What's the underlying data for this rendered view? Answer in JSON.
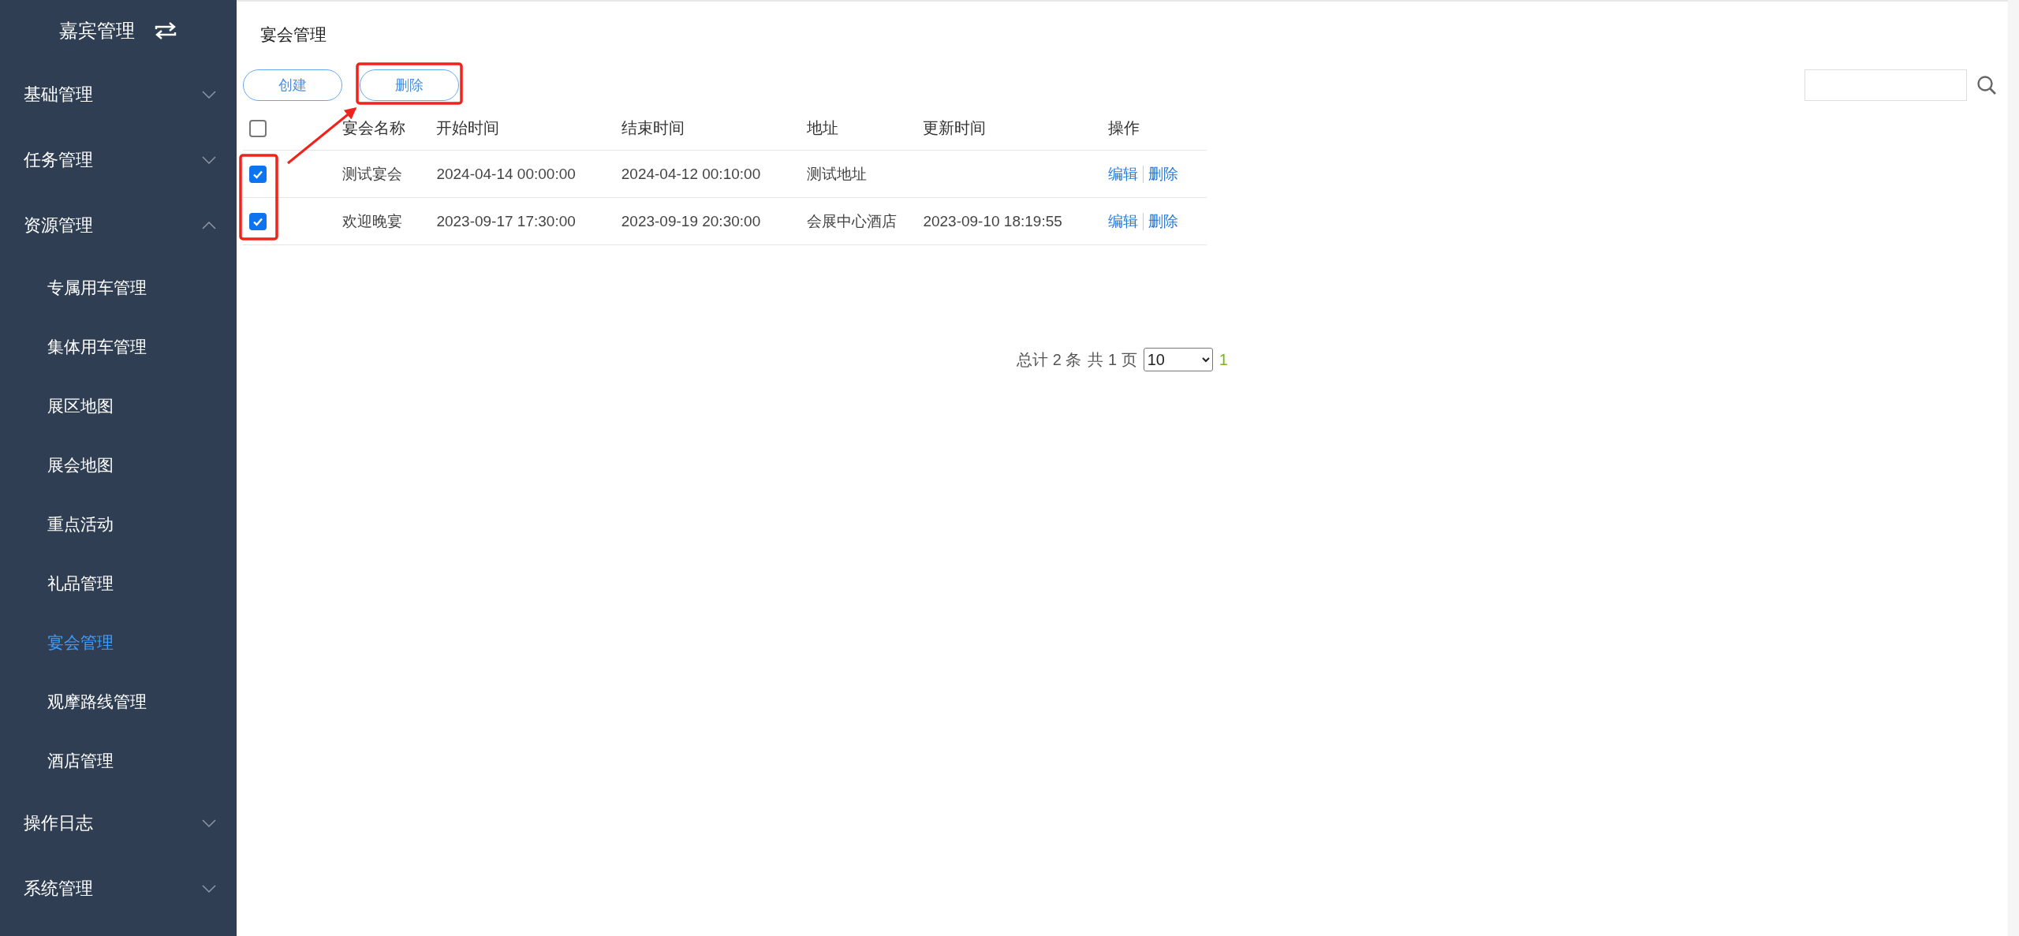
{
  "sidebar": {
    "title": "嘉宾管理",
    "items": [
      {
        "label": "基础管理",
        "expanded": false
      },
      {
        "label": "任务管理",
        "expanded": false
      },
      {
        "label": "资源管理",
        "expanded": true,
        "children": [
          {
            "label": "专属用车管理",
            "selected": false
          },
          {
            "label": "集体用车管理",
            "selected": false
          },
          {
            "label": "展区地图",
            "selected": false
          },
          {
            "label": "展会地图",
            "selected": false
          },
          {
            "label": "重点活动",
            "selected": false
          },
          {
            "label": "礼品管理",
            "selected": false
          },
          {
            "label": "宴会管理",
            "selected": true
          },
          {
            "label": "观摩路线管理",
            "selected": false
          },
          {
            "label": "酒店管理",
            "selected": false
          }
        ]
      },
      {
        "label": "操作日志",
        "expanded": false
      },
      {
        "label": "系统管理",
        "expanded": false
      }
    ]
  },
  "page_title": "宴会管理",
  "toolbar": {
    "buttons": [
      {
        "label": "创建",
        "annotated": false
      },
      {
        "label": "删除",
        "annotated": true
      }
    ]
  },
  "table": {
    "select_all": {
      "checked": false
    },
    "rows_annotated": true,
    "columns": [
      "宴会名称",
      "开始时间",
      "结束时间",
      "地址",
      "更新时间",
      "操作"
    ],
    "rows": [
      {
        "checked": true,
        "name": "测试宴会",
        "start": "2024-04-14 00:00:00",
        "end": "2024-04-12 00:10:00",
        "address": "测试地址",
        "actions": [
          "编辑",
          "删除"
        ]
      },
      {
        "checked": true,
        "name": "欢迎晚宴",
        "start": "2023-09-17 17:30:00",
        "end": "2023-09-19 20:30:00",
        "address": "会展中心酒店",
        "updated": "2023-09-10 18:19:55",
        "actions": [
          "编辑",
          "删除"
        ]
      }
    ]
  },
  "annotation_arrow": true,
  "pagination": {
    "total": "总计 2 条",
    "pages": "共 1 页",
    "page_size": "10",
    "pages_list": [
      {
        "label": "1",
        "selected": true
      }
    ]
  }
}
